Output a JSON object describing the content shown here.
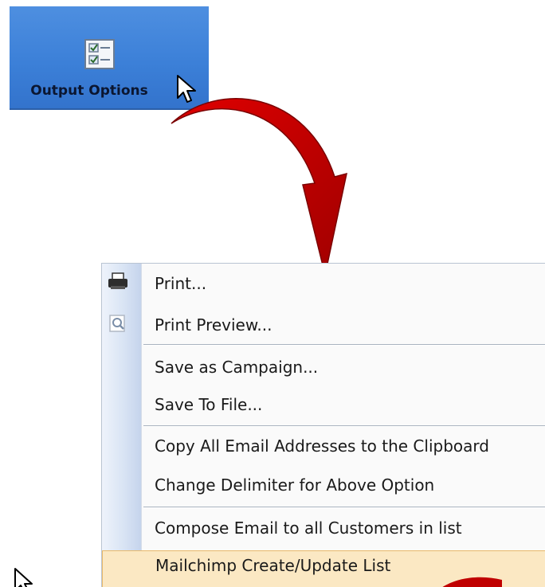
{
  "ribbon": {
    "label": "Output Options",
    "icon": "checklist-icon"
  },
  "annotation": {
    "arrow_color": "#cc0000"
  },
  "menu": {
    "items": [
      {
        "label": "Print...",
        "icon": "printer-icon"
      },
      {
        "label": "Print Preview...",
        "icon": "magnifier-preview-icon"
      },
      {
        "label": "Save as Campaign...",
        "icon": ""
      },
      {
        "label": "Save To File...",
        "icon": ""
      },
      {
        "label": "Copy All Email Addresses to the Clipboard",
        "icon": ""
      },
      {
        "label": "Change Delimiter for Above Option",
        "icon": ""
      },
      {
        "label": "Compose Email to all Customers in list",
        "icon": ""
      },
      {
        "label": "Mailchimp Create/Update List",
        "icon": ""
      }
    ],
    "highlight_color": "#fbe8c3"
  }
}
